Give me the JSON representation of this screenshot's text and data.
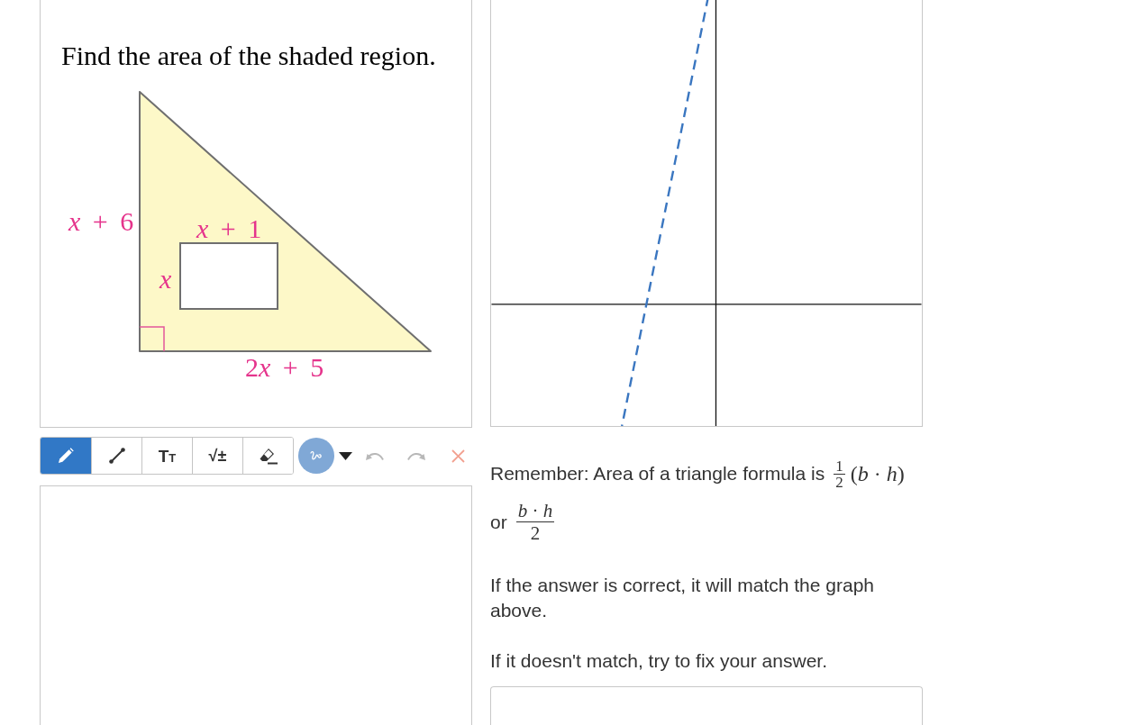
{
  "question": {
    "prompt": "Find the area of the shaded region.",
    "figure_labels": [
      {
        "text": "*x* + 6",
        "italic": false
      },
      {
        "text": "*x* + 1",
        "italic": false
      },
      {
        "text": "x",
        "italic": true
      },
      {
        "prefix": "2",
        "text": "*x* + 5",
        "italic": false
      }
    ]
  },
  "toolbar": {
    "tools": [
      {
        "kind": "pen",
        "selected": true
      },
      {
        "kind": "line",
        "selected": false
      },
      {
        "kind": "text",
        "label": "TT",
        "selected": false
      },
      {
        "kind": "math",
        "label": "√±",
        "selected": false
      },
      {
        "kind": "eraser",
        "selected": false
      }
    ],
    "undo": {
      "disabled": true
    },
    "redo": {
      "disabled": true
    },
    "clear": {
      "disabled": true
    }
  },
  "hints": [
    {
      "kind": "formula",
      "text": "Remember: Area of a triangle formula is",
      "formula": {
        "numerator": "1",
        "denominator": "2",
        "after": "(*b* · *h*)"
      }
    },
    {
      "kind": "formula",
      "text": "or",
      "formula": {
        "numerator": "*b* · *h*",
        "denominator": "2"
      }
    },
    {
      "kind": "paragraph",
      "text": "If the answer is correct, it will match the graph above."
    },
    {
      "kind": "paragraph",
      "text": "If it doesn't match, try to fix your answer."
    }
  ]
}
